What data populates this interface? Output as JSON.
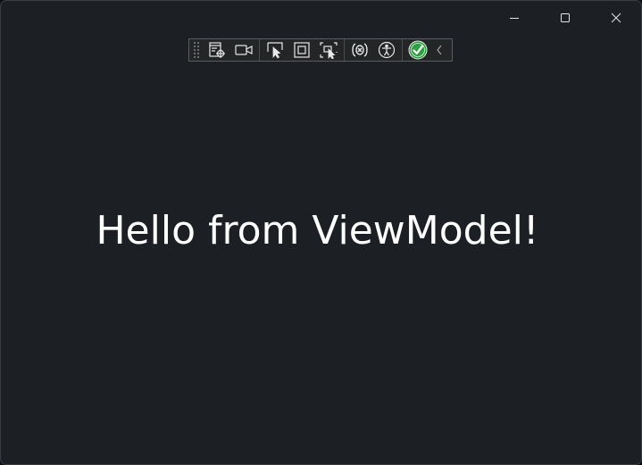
{
  "window": {
    "caption_buttons": {
      "minimize_icon": "minimize-icon",
      "maximize_icon": "maximize-icon",
      "close_icon": "close-icon"
    }
  },
  "toolbar": {
    "icons": [
      "visual-tree-icon",
      "video-camera-icon",
      "select-element-icon",
      "display-layout-adorners-icon",
      "track-focused-element-icon",
      "binding-failures-icon",
      "accessibility-icon",
      "accessibility-checker-ok-icon",
      "collapse-chevron-icon"
    ],
    "accent_color": "#2ea043"
  },
  "content": {
    "message": "Hello from ViewModel!"
  },
  "colors": {
    "window_background": "#1c2025",
    "text": "#ffffff"
  }
}
